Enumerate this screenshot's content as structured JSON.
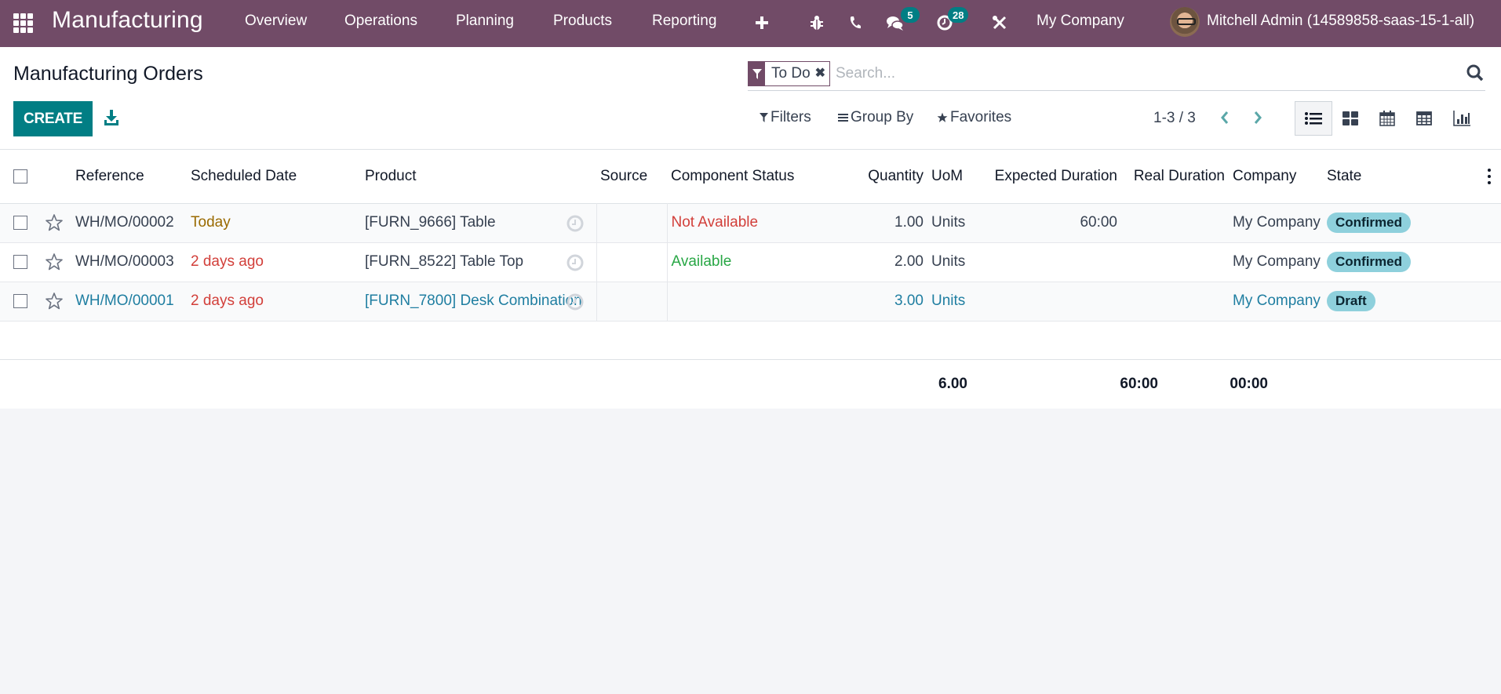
{
  "navbar": {
    "app_name": "Manufacturing",
    "menu": [
      "Overview",
      "Operations",
      "Planning",
      "Products",
      "Reporting"
    ],
    "messages_count": "5",
    "activities_count": "28",
    "company": "My Company",
    "user": "Mitchell Admin (14589858-saas-15-1-all)",
    "bg_color": "#714b67"
  },
  "control_panel": {
    "title": "Manufacturing Orders",
    "create_label": "CREATE",
    "search": {
      "facet_value": "To Do",
      "placeholder": "Search..."
    },
    "filters_label": "Filters",
    "group_by_label": "Group By",
    "favorites_label": "Favorites",
    "pager": "1-3 / 3",
    "views": [
      "list",
      "kanban",
      "calendar",
      "pivot",
      "graph"
    ],
    "active_view": "list"
  },
  "table": {
    "columns": [
      "Reference",
      "Scheduled Date",
      "Product",
      "Source",
      "Component Status",
      "Quantity",
      "UoM",
      "Expected Duration",
      "Real Duration",
      "Company",
      "State"
    ],
    "rows": [
      {
        "reference": "WH/MO/00002",
        "scheduled_date": "Today",
        "date_status": "today",
        "product": "[FURN_9666] Table",
        "source": "",
        "component_status": "Not Available",
        "component_state": "unavailable",
        "quantity": "1.00",
        "uom": "Units",
        "expected_duration": "60:00",
        "real_duration": "",
        "company": "My Company",
        "state": "Confirmed"
      },
      {
        "reference": "WH/MO/00003",
        "scheduled_date": "2 days ago",
        "date_status": "late",
        "product": "[FURN_8522] Table Top",
        "source": "",
        "component_status": "Available",
        "component_state": "available",
        "quantity": "2.00",
        "uom": "Units",
        "expected_duration": "",
        "real_duration": "",
        "company": "My Company",
        "state": "Confirmed"
      },
      {
        "reference": "WH/MO/00001",
        "scheduled_date": "2 days ago",
        "date_status": "late",
        "product": "[FURN_7800] Desk Combination",
        "source": "",
        "component_status": "",
        "component_state": "",
        "quantity": "3.00",
        "uom": "Units",
        "expected_duration": "",
        "real_duration": "",
        "company": "My Company",
        "state": "Draft"
      }
    ],
    "totals": {
      "quantity": "6.00",
      "expected_duration": "60:00",
      "real_duration": "00:00"
    }
  },
  "colors": {
    "primary": "#017e84",
    "today": "#9a6a00",
    "late": "#d23f3a",
    "available": "#28a745",
    "draft_link": "#1f7ea1",
    "state_pill": "#8ed0dc"
  }
}
